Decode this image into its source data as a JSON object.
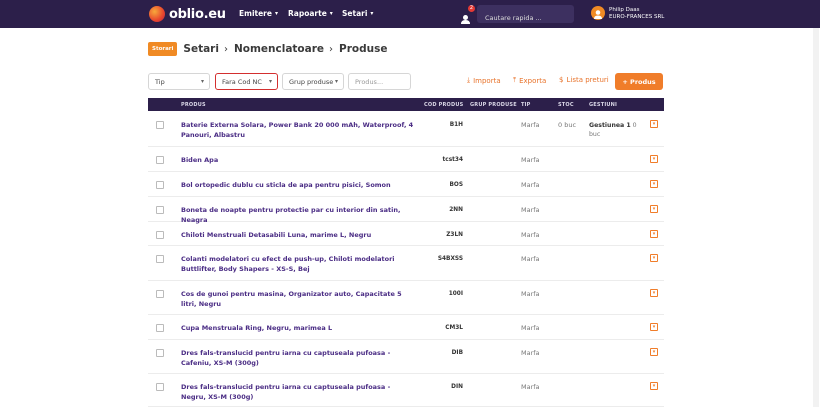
{
  "nav": {
    "logo_text": "oblio.eu",
    "menu": [
      {
        "label": "Emitere",
        "chevron": "▾"
      },
      {
        "label": "Rapoarte",
        "chevron": "▾"
      },
      {
        "label": "Setari",
        "chevron": "▾"
      }
    ],
    "notifications_count": "2",
    "search_placeholder": "Cautare rapida ...",
    "user_name": "Philip Daas",
    "company": "EURO-FRANCES SRL"
  },
  "breadcrumb": {
    "button": "Storari",
    "items": [
      "Setari",
      "Nomenclatoare",
      "Produse"
    ]
  },
  "filters": {
    "tip": "Tip",
    "cod_nc": "Fara Cod NC",
    "grup": "Grup produse",
    "produs_placeholder": "Produs..."
  },
  "actions": {
    "importa": "Importa",
    "exporta": "Exporta",
    "lista_preturi": "Lista preturi",
    "add": "+ Produs"
  },
  "table": {
    "headers": {
      "produs": "PRODUS",
      "cod": "COD PRODUS",
      "grup": "GRUP PRODUSE",
      "tip": "TIP",
      "stoc": "STOC",
      "gestiuni": "GESTIUNI"
    },
    "rows": [
      {
        "name": "Baterie Externa Solara, Power Bank 20 000 mAh, Waterproof, 4 Panouri, Albastru",
        "code": "B1H",
        "type": "Marfa",
        "stoc": "0 buc",
        "gest_name": "Gestiunea 1",
        "gest_qty": "0 buc"
      },
      {
        "name": "Biden Apa",
        "code": "tcst34",
        "type": "Marfa",
        "stoc": "",
        "gest_name": "",
        "gest_qty": ""
      },
      {
        "name": "Bol ortopedic dublu cu sticla de apa pentru pisici, Somon",
        "code": "BOS",
        "type": "Marfa",
        "stoc": "",
        "gest_name": "",
        "gest_qty": ""
      },
      {
        "name": "Boneta de noapte pentru protectie par cu interior din satin, Neagra",
        "code": "2NN",
        "type": "Marfa",
        "stoc": "",
        "gest_name": "",
        "gest_qty": ""
      },
      {
        "name": "Chiloti Menstruali Detasabili Luna, marime L, Negru",
        "code": "Z3LN",
        "type": "Marfa",
        "stoc": "",
        "gest_name": "",
        "gest_qty": ""
      },
      {
        "name": "Colanti modelatori cu efect de push-up, Chiloti modelatori Buttlifter, Body Shapers - XS-S, Bej",
        "code": "S4BXSS",
        "type": "Marfa",
        "stoc": "",
        "gest_name": "",
        "gest_qty": ""
      },
      {
        "name": "Cos de gunoi pentru masina, Organizator auto, Capacitate 5 litri, Negru",
        "code": "100I",
        "type": "Marfa",
        "stoc": "",
        "gest_name": "",
        "gest_qty": ""
      },
      {
        "name": "Cupa Menstruala Ring, Negru, marimea L",
        "code": "CM3L",
        "type": "Marfa",
        "stoc": "",
        "gest_name": "",
        "gest_qty": ""
      },
      {
        "name": "Dres fals-translucid pentru iarna cu captuseala pufoasa - Cafeniu, XS-M (300g)",
        "code": "DIB",
        "type": "Marfa",
        "stoc": "",
        "gest_name": "",
        "gest_qty": ""
      },
      {
        "name": "Dres fals-translucid pentru iarna cu captuseala pufoasa - Negru, XS-M (300g)",
        "code": "DIN",
        "type": "Marfa",
        "stoc": "",
        "gest_name": "",
        "gest_qty": ""
      }
    ]
  },
  "colors": {
    "nav_bg": "#2c1f4a",
    "accent": "#f07d2a",
    "link": "#4a2c84",
    "active_filter_border": "#d32f2f"
  },
  "icons": [
    "notification-bell-icon",
    "user-avatar-icon",
    "import-icon",
    "export-icon",
    "price-list-icon",
    "row-action-icon"
  ]
}
